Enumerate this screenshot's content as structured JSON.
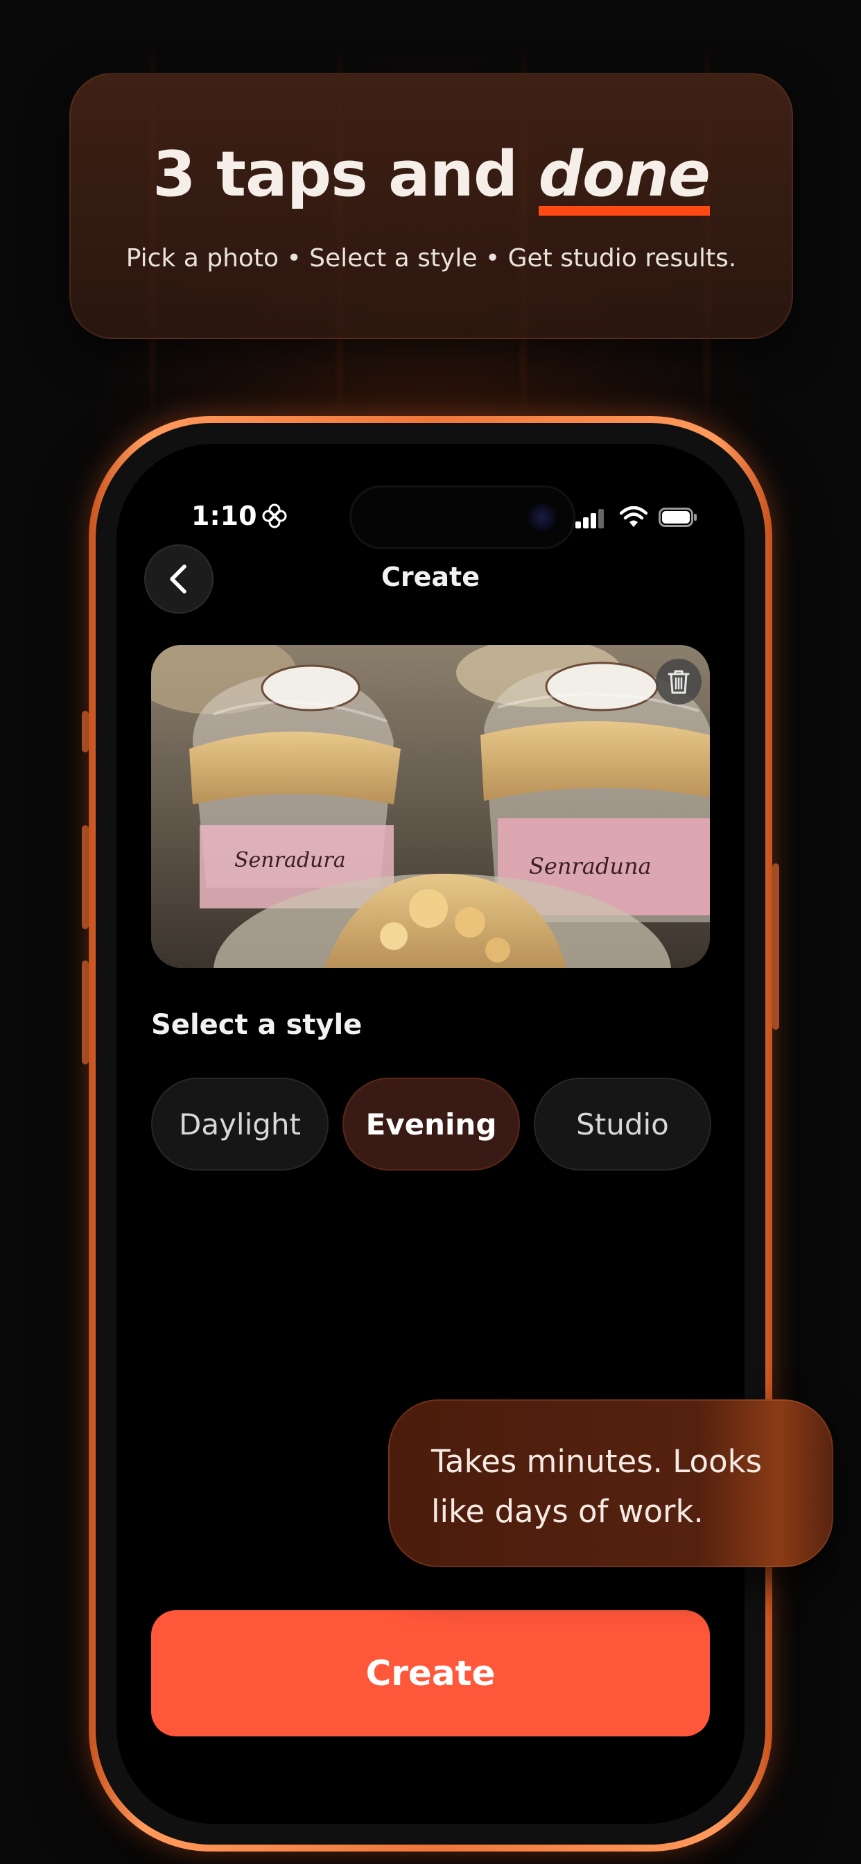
{
  "headline": {
    "title_main": "3 taps and ",
    "title_emphasis": "done",
    "subtitle": "Pick a photo • Select a style • Get studio results."
  },
  "status_bar": {
    "time": "1:10",
    "flower_icon": "flower-icon",
    "signal_icon": "cellular-signal-icon",
    "wifi_icon": "wifi-icon",
    "battery_icon": "battery-icon"
  },
  "nav": {
    "back_icon": "chevron-left-icon",
    "title": "Create"
  },
  "photo": {
    "trash_icon": "trash-icon"
  },
  "styles": {
    "label": "Select a style",
    "options": [
      "Daylight",
      "Evening",
      "Studio"
    ],
    "selected": "Evening"
  },
  "tooltip": {
    "text": "Takes minutes. Looks like days of work."
  },
  "actions": {
    "create_label": "Create"
  },
  "colors": {
    "accent": "#ff573a",
    "underline": "#ff4a15",
    "phone_frame": "#f0763a",
    "selected_chip": "#3a1a15"
  }
}
